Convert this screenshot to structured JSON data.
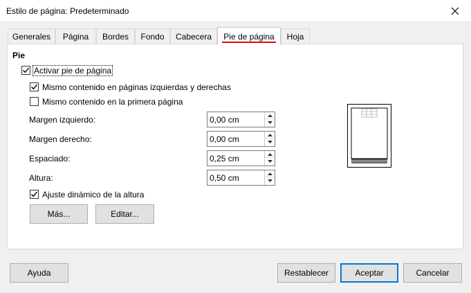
{
  "window": {
    "title": "Estilo de página: Predeterminado"
  },
  "tabs": [
    {
      "label": "Generales"
    },
    {
      "label": "Página"
    },
    {
      "label": "Bordes"
    },
    {
      "label": "Fondo"
    },
    {
      "label": "Cabecera"
    },
    {
      "label": "Pie de página",
      "selected": true
    },
    {
      "label": "Hoja"
    }
  ],
  "footer": {
    "section_title": "Pie",
    "activate": {
      "label": "Activar pie de página",
      "checked": true
    },
    "same_left_right": {
      "label": "Mismo contenido en páginas izquierdas y derechas",
      "checked": true
    },
    "same_first": {
      "label": "Mismo contenido en la primera página",
      "checked": false
    },
    "left_margin": {
      "label": "Margen izquierdo:",
      "value": "0,00 cm"
    },
    "right_margin": {
      "label": "Margen derecho:",
      "value": "0,00 cm"
    },
    "spacing": {
      "label": "Espaciado:",
      "value": "0,25 cm"
    },
    "height": {
      "label": "Altura:",
      "value": "0,50 cm"
    },
    "autofit": {
      "label": "Ajuste dinámico de la altura",
      "checked": true
    },
    "more_button": "Más...",
    "edit_button": "Editar..."
  },
  "buttons": {
    "help": "Ayuda",
    "reset": "Restablecer",
    "ok": "Aceptar",
    "cancel": "Cancelar"
  },
  "colors": {
    "active_tab_accent": "#e60012",
    "default_button_border": "#0078d7"
  }
}
